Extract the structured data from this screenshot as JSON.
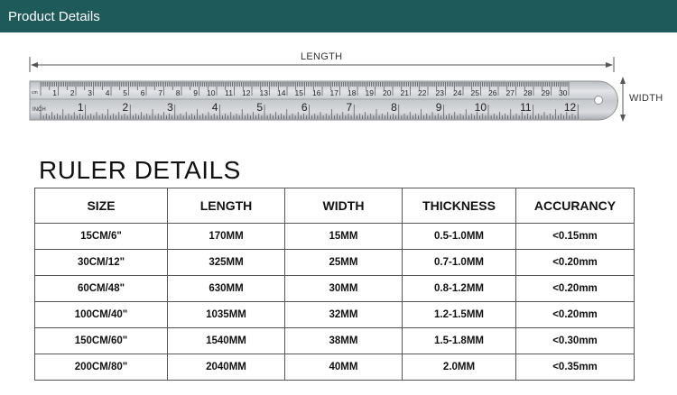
{
  "header": {
    "title": "Product Details"
  },
  "diagram": {
    "length_label": "LENGTH",
    "width_label": "WIDTH",
    "ruler": {
      "cm_prefix": "cm",
      "inch_prefix": "INCH",
      "cm_numbers": [
        "1",
        "2",
        "3",
        "4",
        "5",
        "6",
        "7",
        "8",
        "9",
        "10",
        "11",
        "12",
        "13",
        "14",
        "15",
        "16",
        "17",
        "18",
        "19",
        "20",
        "21",
        "22",
        "23",
        "24",
        "25",
        "26",
        "27",
        "28",
        "29",
        "30"
      ],
      "inch_numbers": [
        "1",
        "2",
        "3",
        "4",
        "5",
        "6",
        "7",
        "8",
        "9",
        "10",
        "11",
        "12"
      ]
    }
  },
  "section_title": "RULER DETAILS",
  "table": {
    "headers": [
      "SIZE",
      "LENGTH",
      "WIDTH",
      "THICKNESS",
      "ACCURANCY"
    ],
    "rows": [
      [
        "15CM/6\"",
        "170MM",
        "15MM",
        "0.5-1.0MM",
        "<0.15mm"
      ],
      [
        "30CM/12\"",
        "325MM",
        "25MM",
        "0.7-1.0MM",
        "<0.20mm"
      ],
      [
        "60CM/48\"",
        "630MM",
        "30MM",
        "0.8-1.2MM",
        "<0.20mm"
      ],
      [
        "100CM/40\"",
        "1035MM",
        "32MM",
        "1.2-1.5MM",
        "<0.20mm"
      ],
      [
        "150CM/60\"",
        "1540MM",
        "38MM",
        "1.5-1.8MM",
        "<0.30mm"
      ],
      [
        "200CM/80\"",
        "2040MM",
        "40MM",
        "2.0MM",
        "<0.35mm"
      ]
    ]
  },
  "colors": {
    "header_bg": "#1f5a5b",
    "ruler_steel": "#c9ccd0"
  }
}
